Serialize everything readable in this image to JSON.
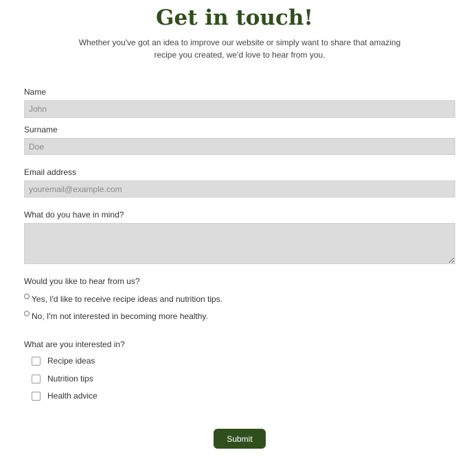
{
  "header": {
    "title": "Get in touch!",
    "subtitle": "Whether you've got an idea to improve our website or simply want to share that amazing recipe you created, we'd love to hear from you."
  },
  "form": {
    "name": {
      "label": "Name",
      "placeholder": "John",
      "value": ""
    },
    "surname": {
      "label": "Surname",
      "placeholder": "Doe",
      "value": ""
    },
    "email": {
      "label": "Email address",
      "placeholder": "youremail@example.com",
      "value": ""
    },
    "message": {
      "label": "What do you have in mind?",
      "placeholder": "",
      "value": ""
    },
    "newsletter": {
      "label": "Would you like to hear from us?",
      "options": [
        {
          "label": "Yes, I'd like to receive recipe ideas and nutrition tips.",
          "selected": false
        },
        {
          "label": "No, I'm not interested in becoming more healthy.",
          "selected": false
        }
      ]
    },
    "interests": {
      "label": "What are you interested in?",
      "options": [
        {
          "label": "Recipe ideas",
          "checked": false
        },
        {
          "label": "Nutrition tips",
          "checked": false
        },
        {
          "label": "Health advice",
          "checked": false
        }
      ]
    },
    "submit_label": "Submit"
  },
  "colors": {
    "accent": "#2f4f1c",
    "field_background": "#dcdcdc",
    "text": "#333333"
  }
}
